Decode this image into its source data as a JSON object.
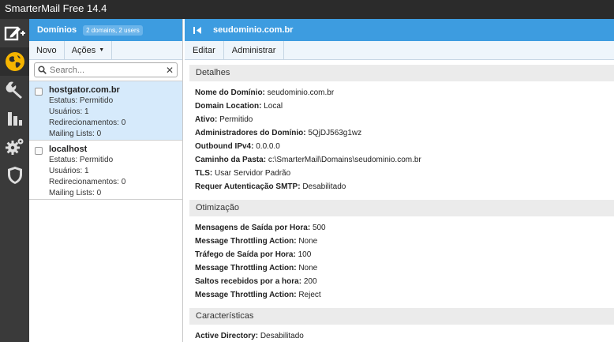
{
  "app": {
    "title": "SmarterMail Free 14.4"
  },
  "nav": {
    "items": [
      {
        "name": "new-compose-icon"
      },
      {
        "name": "globe-icon"
      },
      {
        "name": "wrench-icon"
      },
      {
        "name": "bar-chart-icon"
      },
      {
        "name": "gears-icon"
      },
      {
        "name": "shield-icon"
      }
    ]
  },
  "domains_panel": {
    "title": "Domínios",
    "badge": "2 domains, 2 users",
    "toolbar": {
      "new": "Novo",
      "actions": "Ações"
    },
    "search": {
      "placeholder": "Search..."
    },
    "items": [
      {
        "name": "hostgator.com.br",
        "status": "Estatus: Permitido",
        "users": "Usuários: 1",
        "forwards": "Redirecionamentos: 0",
        "mailing": "Mailing Lists: 0",
        "selected": true
      },
      {
        "name": "localhost",
        "status": "Estatus: Permitido",
        "users": "Usuários: 1",
        "forwards": "Redirecionamentos: 0",
        "mailing": "Mailing Lists: 0",
        "selected": false
      }
    ]
  },
  "details_panel": {
    "title": "seudominio.com.br",
    "toolbar": {
      "edit": "Editar",
      "admin": "Administrar"
    },
    "sections": [
      {
        "title": "Detalhes",
        "rows": [
          {
            "label": "Nome do Domínio:",
            "value": "seudominio.com.br"
          },
          {
            "label": "Domain Location:",
            "value": "Local"
          },
          {
            "label": "Ativo:",
            "value": "Permitido"
          },
          {
            "label": "Administradores do Domínio:",
            "value": "5QjDJ563g1wz"
          },
          {
            "label": "Outbound IPv4:",
            "value": "0.0.0.0"
          },
          {
            "label": "Caminho da Pasta:",
            "value": "c:\\SmarterMail\\Domains\\seudominio.com.br"
          },
          {
            "label": "TLS:",
            "value": "Usar Servidor Padrão"
          },
          {
            "label": "Requer Autenticação SMTP:",
            "value": "Desabilitado"
          }
        ]
      },
      {
        "title": "Otimização",
        "rows": [
          {
            "label": "Mensagens de Saída por Hora:",
            "value": "500"
          },
          {
            "label": "Message Throttling Action:",
            "value": "None"
          },
          {
            "label": "Tráfego de Saída por Hora:",
            "value": "100"
          },
          {
            "label": "Message Throttling Action:",
            "value": "None"
          },
          {
            "label": "Saltos recebidos por a hora:",
            "value": "200"
          },
          {
            "label": "Message Throttling Action:",
            "value": "Reject"
          }
        ]
      },
      {
        "title": "Características",
        "rows": [
          {
            "label": "Active Directory:",
            "value": "Desabilitado"
          }
        ]
      }
    ]
  },
  "colors": {
    "accent": "#3d9ce0",
    "navbar": "#3a3a3a",
    "titlebar": "#2b2b2b",
    "selected": "#d6eafb",
    "globe": "#f5b400"
  }
}
